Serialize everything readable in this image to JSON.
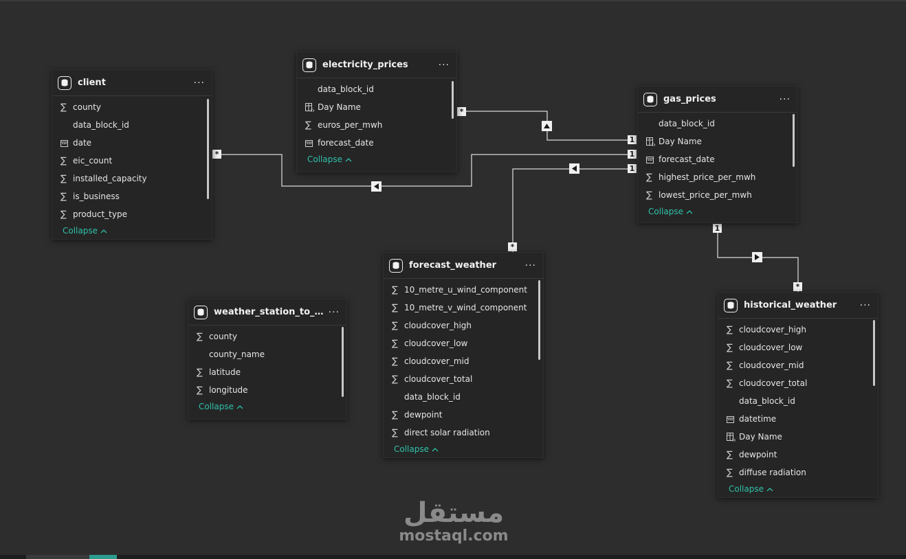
{
  "tables": {
    "client": {
      "title": "client",
      "fields": [
        {
          "name": "county",
          "icon": "sigma-icon"
        },
        {
          "name": "data_block_id",
          "icon": ""
        },
        {
          "name": "date",
          "icon": "calendar-icon"
        },
        {
          "name": "eic_count",
          "icon": "sigma-icon"
        },
        {
          "name": "installed_capacity",
          "icon": "sigma-icon"
        },
        {
          "name": "is_business",
          "icon": "sigma-icon"
        },
        {
          "name": "product_type",
          "icon": "sigma-icon"
        }
      ],
      "collapse": "Collapse"
    },
    "electricity_prices": {
      "title": "electricity_prices",
      "fields": [
        {
          "name": "data_block_id",
          "icon": ""
        },
        {
          "name": "Day Name",
          "icon": "calculated-column-icon"
        },
        {
          "name": "euros_per_mwh",
          "icon": "sigma-icon"
        },
        {
          "name": "forecast_date",
          "icon": "calendar-icon"
        }
      ],
      "collapse": "Collapse"
    },
    "gas_prices": {
      "title": "gas_prices",
      "fields": [
        {
          "name": "data_block_id",
          "icon": ""
        },
        {
          "name": "Day Name",
          "icon": "calculated-column-icon"
        },
        {
          "name": "forecast_date",
          "icon": "calendar-icon"
        },
        {
          "name": "highest_price_per_mwh",
          "icon": "sigma-icon"
        },
        {
          "name": "lowest_price_per_mwh",
          "icon": "sigma-icon"
        }
      ],
      "collapse": "Collapse"
    },
    "forecast_weather": {
      "title": "forecast_weather",
      "fields": [
        {
          "name": "10_metre_u_wind_component",
          "icon": "sigma-icon"
        },
        {
          "name": "10_metre_v_wind_component",
          "icon": "sigma-icon"
        },
        {
          "name": "cloudcover_high",
          "icon": "sigma-icon"
        },
        {
          "name": "cloudcover_low",
          "icon": "sigma-icon"
        },
        {
          "name": "cloudcover_mid",
          "icon": "sigma-icon"
        },
        {
          "name": "cloudcover_total",
          "icon": "sigma-icon"
        },
        {
          "name": "data_block_id",
          "icon": ""
        },
        {
          "name": "dewpoint",
          "icon": "sigma-icon"
        },
        {
          "name": "direct solar radiation",
          "icon": "sigma-icon"
        }
      ],
      "collapse": "Collapse"
    },
    "weather_station_to_county": {
      "title": "weather_station_to_cou...",
      "fields": [
        {
          "name": "county",
          "icon": "sigma-icon"
        },
        {
          "name": "county_name",
          "icon": ""
        },
        {
          "name": "latitude",
          "icon": "sigma-icon"
        },
        {
          "name": "longitude",
          "icon": "sigma-icon"
        }
      ],
      "collapse": "Collapse"
    },
    "historical_weather": {
      "title": "historical_weather",
      "fields": [
        {
          "name": "cloudcover_high",
          "icon": "sigma-icon"
        },
        {
          "name": "cloudcover_low",
          "icon": "sigma-icon"
        },
        {
          "name": "cloudcover_mid",
          "icon": "sigma-icon"
        },
        {
          "name": "cloudcover_total",
          "icon": "sigma-icon"
        },
        {
          "name": "data_block_id",
          "icon": ""
        },
        {
          "name": "datetime",
          "icon": "calendar-icon"
        },
        {
          "name": "Day Name",
          "icon": "calculated-column-icon"
        },
        {
          "name": "dewpoint",
          "icon": "sigma-icon"
        },
        {
          "name": "diffuse radiation",
          "icon": "sigma-icon"
        }
      ],
      "collapse": "Collapse"
    }
  },
  "more_label": "···",
  "cardinality": {
    "one": "1",
    "many": "*"
  },
  "colors": {
    "accent": "#2fc1a8",
    "canvas": "#2d2d2d",
    "card": "#252525",
    "line": "#bdbdbd"
  },
  "watermark": {
    "arabic": "مستقل",
    "latin": "mostaql.com"
  }
}
